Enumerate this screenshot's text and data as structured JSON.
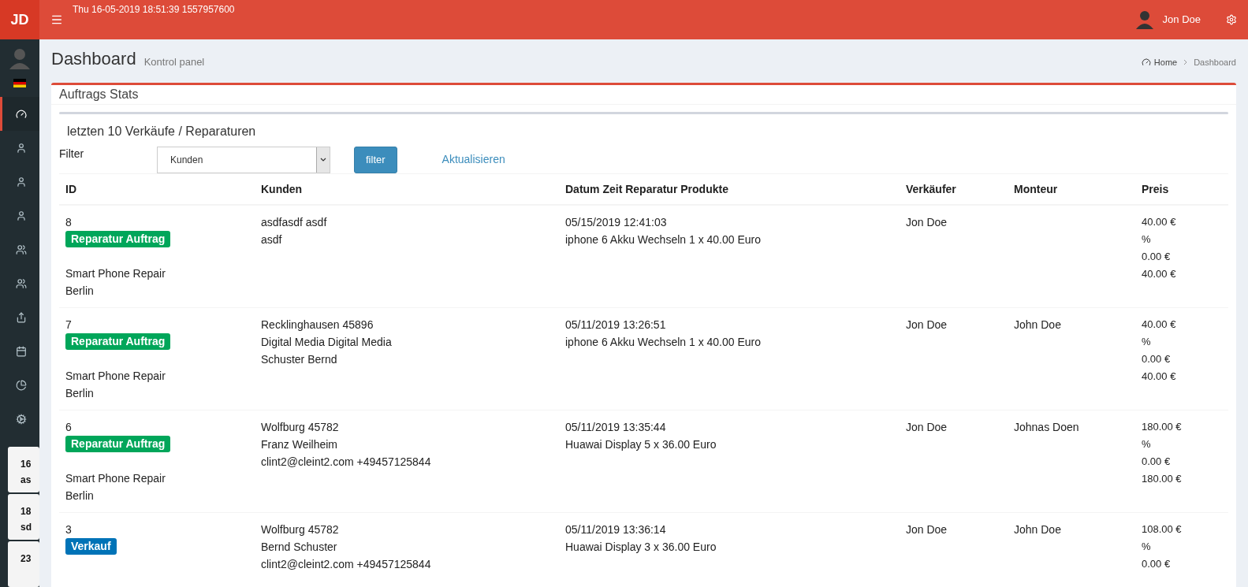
{
  "brand": "JD",
  "topbar": {
    "datetime": "Thu 16-05-2019 18:51:39 1557957600",
    "user": "Jon Doe"
  },
  "sidebar": {
    "items": [
      {
        "kind": "dashboard",
        "selected": true
      },
      {
        "kind": "person",
        "selected": false
      },
      {
        "kind": "person",
        "selected": false
      },
      {
        "kind": "person",
        "selected": false
      },
      {
        "kind": "users",
        "selected": false
      },
      {
        "kind": "users",
        "selected": false
      },
      {
        "kind": "share",
        "selected": false
      },
      {
        "kind": "calendar",
        "selected": false
      },
      {
        "kind": "pie",
        "selected": false
      },
      {
        "kind": "cogs",
        "selected": false
      }
    ],
    "cards": [
      {
        "lines": [
          "16",
          "as"
        ]
      },
      {
        "lines": [
          "18",
          "sd"
        ]
      },
      {
        "lines": [
          "23"
        ]
      }
    ]
  },
  "page": {
    "title": "Dashboard",
    "subtitle": "Kontrol panel",
    "breadcrumb": [
      "Home",
      "Dashboard"
    ]
  },
  "box": {
    "title": "Auftrags Stats",
    "subtitle": "letzten 10 Verkäufe / Reparaturen",
    "filter": {
      "label": "Filter",
      "value": "Kunden",
      "button": "filter",
      "link": "Aktualisieren"
    },
    "table": {
      "columns": [
        "ID",
        "Kunden",
        "Datum Zeit Reparatur Produkte",
        "Verkäufer",
        "Monteur",
        "Preis"
      ],
      "rows": [
        {
          "id": "8",
          "badge": {
            "label": "Reparatur Auftrag",
            "color": "#00a65a"
          },
          "location": [
            "Smart Phone Repair",
            "Berlin"
          ],
          "customer": [
            "asdfasdf asdf",
            "asdf"
          ],
          "details": [
            "05/15/2019 12:41:03",
            "iphone 6 Akku Wechseln 1 x 40.00 Euro"
          ],
          "seller": "Jon Doe",
          "price": [
            "40.00 €",
            "%",
            "0.00 €",
            "40.00 €"
          ]
        },
        {
          "id": "7",
          "badge": {
            "label": "Reparatur Auftrag",
            "color": "#00a65a"
          },
          "location": [
            "Smart Phone Repair",
            "Berlin"
          ],
          "customer": [
            "Recklinghausen 45896",
            "Digital Media Digital Media",
            "Schuster Bernd"
          ],
          "details": [
            "05/11/2019 13:26:51",
            "iphone 6 Akku Wechseln 1 x 40.00 Euro"
          ],
          "seller": "Jon Doe",
          "mechanic": "John Doe",
          "price": [
            "40.00 €",
            "%",
            "0.00 €",
            "40.00 €"
          ]
        },
        {
          "id": "6",
          "badge": {
            "label": "Reparatur Auftrag",
            "color": "#00a65a"
          },
          "location": [
            "Smart Phone Repair",
            "Berlin"
          ],
          "customer": [
            "Wolfburg 45782",
            "Franz Weilheim",
            "clint2@cleint2.com +49457125844"
          ],
          "details": [
            "05/11/2019 13:35:44",
            "Huawai Display 5 x 36.00 Euro"
          ],
          "seller": "Jon Doe",
          "mechanic": "Johnas Doen",
          "price": [
            "180.00 €",
            "%",
            "0.00 €",
            "180.00 €"
          ]
        },
        {
          "id": "3",
          "badge": {
            "label": "Verkauf",
            "color": "#0073b7"
          },
          "location": [],
          "customer": [
            "Wolfburg 45782",
            "Bernd Schuster",
            "clint2@cleint2.com +49457125844"
          ],
          "details": [
            "05/11/2019 13:36:14",
            "Huawai Display 3 x 36.00 Euro"
          ],
          "seller": "Jon Doe",
          "mechanic": "John Doe",
          "price": [
            "108.00 €",
            "%",
            "0.00 €"
          ]
        }
      ]
    }
  }
}
